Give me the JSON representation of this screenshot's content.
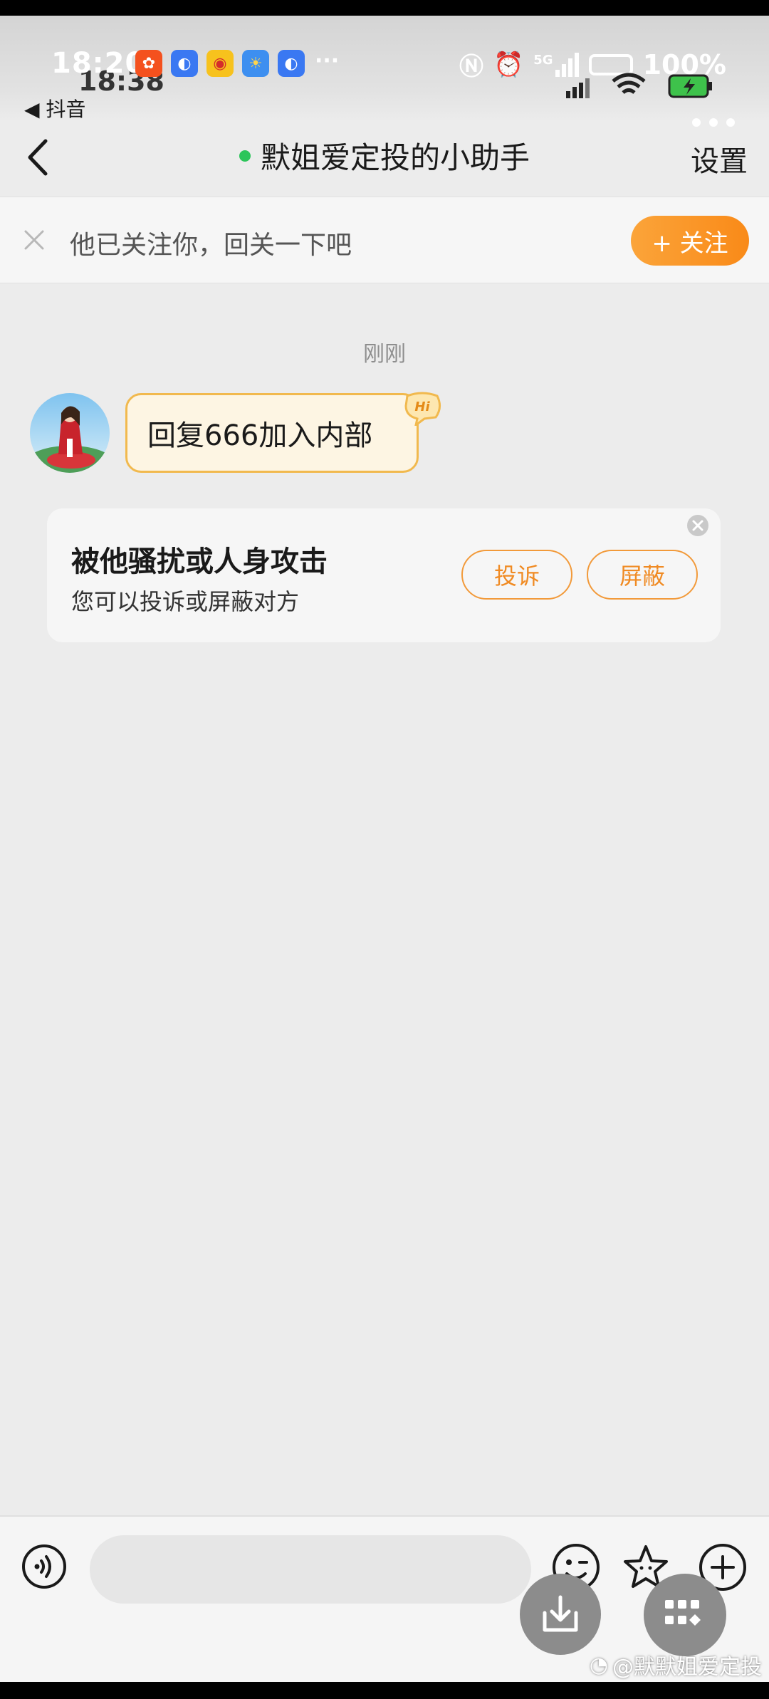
{
  "status_bar": {
    "time": "18:20",
    "ghost_time": "18:38",
    "battery": "100%",
    "network": "5G",
    "back_app": "◀ 抖音"
  },
  "header": {
    "title": "默姐爱定投的小助手",
    "settings_label": "设置",
    "online_color": "#2cc55a"
  },
  "follow_banner": {
    "text": "他已关注你，回关一下吧",
    "follow_button": "+ 关注",
    "accent_color": "#f98a18"
  },
  "chat": {
    "timestamp": "刚刚",
    "messages": [
      {
        "text": "回复666加入内部",
        "badge": "Hi"
      }
    ]
  },
  "report_card": {
    "title": "被他骚扰或人身攻击",
    "subtitle": "您可以投诉或屏蔽对方",
    "complain_label": "投诉",
    "block_label": "屏蔽"
  },
  "input_bar": {
    "value": "",
    "icons": [
      "voice-icon",
      "emoji-icon",
      "star-icon",
      "plus-icon"
    ]
  },
  "floating_buttons": [
    "download-icon",
    "apps-icon"
  ],
  "watermark": "@默默姐爱定投"
}
